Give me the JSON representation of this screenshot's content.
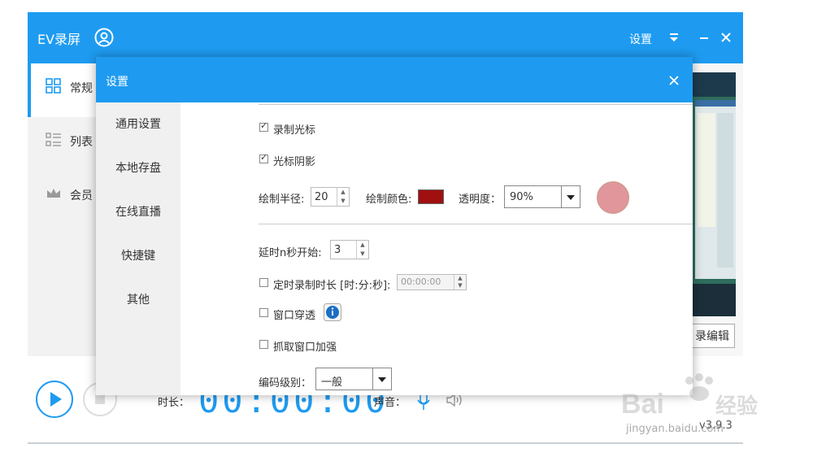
{
  "main": {
    "app_title": "EV录屏",
    "settings_label": "设置",
    "sidebar": [
      {
        "label": "常规",
        "icon": "grid-icon"
      },
      {
        "label": "列表",
        "icon": "list-icon"
      },
      {
        "label": "会员",
        "icon": "crown-icon"
      }
    ],
    "edit_button": "录编辑",
    "duration_label": "时长：",
    "timer": "00:00:00",
    "sound_label": "声音：",
    "version": "v3.9.3"
  },
  "dialog": {
    "title": "设置",
    "nav": [
      "通用设置",
      "本地存盘",
      "在线直播",
      "快捷键",
      "其他"
    ],
    "record_cursor": {
      "label": "录制光标",
      "checked": true
    },
    "cursor_shadow": {
      "label": "光标阴影",
      "checked": true
    },
    "draw_radius": {
      "label": "绘制半径:",
      "value": "20"
    },
    "draw_color": {
      "label": "绘制颜色:",
      "color": "#a01010"
    },
    "opacity": {
      "label": "透明度：",
      "value": "90%"
    },
    "preview_color": "#e0969a",
    "delay_start": {
      "label": "延时n秒开始:",
      "value": "3"
    },
    "timed_record": {
      "label": "定时录制时长 [时:分:秒]:",
      "value": "00:00:00",
      "checked": false
    },
    "window_through": {
      "label": "窗口穿透",
      "checked": false
    },
    "capture_enhance": {
      "label": "抓取窗口加强",
      "checked": false
    },
    "encode_level": {
      "label": "编码级别：",
      "value": "一般"
    }
  },
  "watermark": {
    "brand": "Baidu经验",
    "url": "jingyan.baidu.com"
  },
  "colors": {
    "accent": "#1e9bf0",
    "draw_color": "#a01010"
  }
}
